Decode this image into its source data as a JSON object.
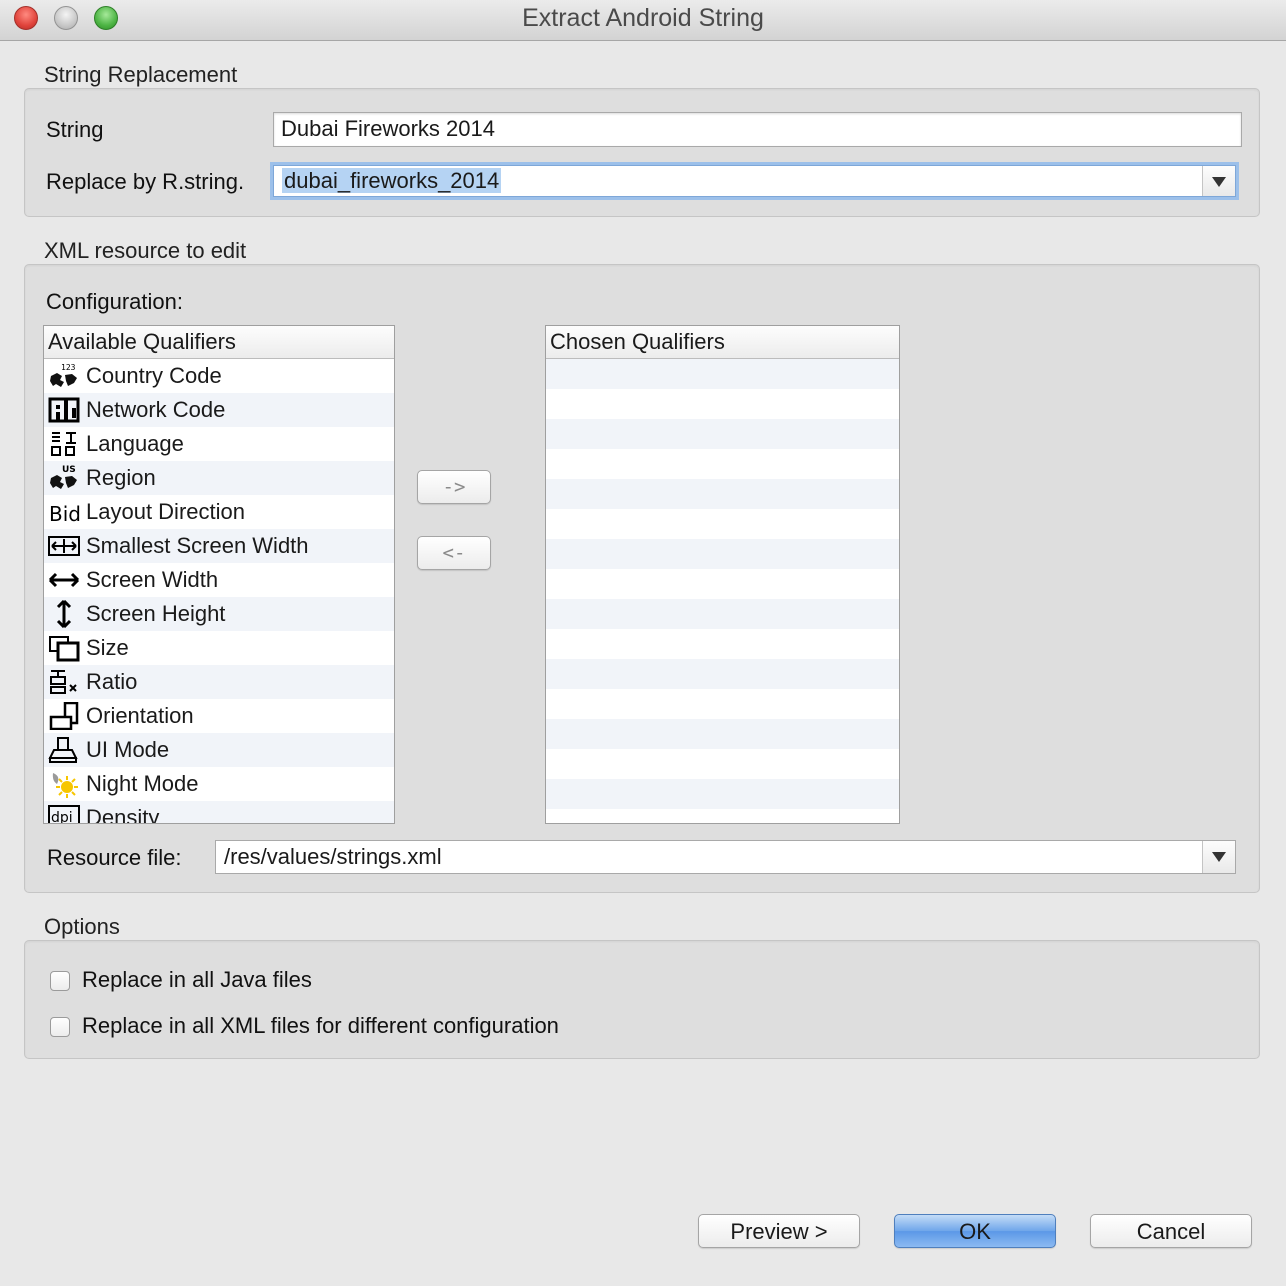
{
  "window": {
    "title": "Extract Android String"
  },
  "string_replacement": {
    "section_label": "String Replacement",
    "string_label": "String",
    "string_value": "Dubai Fireworks 2014",
    "replace_label": "Replace by R.string.",
    "replace_value": "dubai_fireworks_2014"
  },
  "xml_resource": {
    "section_label": "XML resource to edit",
    "configuration_label": "Configuration:",
    "available_header": "Available Qualifiers",
    "chosen_header": "Chosen Qualifiers",
    "add_button": "->",
    "remove_button": "<-",
    "qualifiers": [
      {
        "label": "Country Code",
        "icon": "country-code-icon"
      },
      {
        "label": "Network Code",
        "icon": "network-code-icon"
      },
      {
        "label": "Language",
        "icon": "language-icon"
      },
      {
        "label": "Region",
        "icon": "region-icon"
      },
      {
        "label": "Layout Direction",
        "icon": "layout-direction-icon"
      },
      {
        "label": "Smallest Screen Width",
        "icon": "smallest-screen-width-icon"
      },
      {
        "label": "Screen Width",
        "icon": "screen-width-icon"
      },
      {
        "label": "Screen Height",
        "icon": "screen-height-icon"
      },
      {
        "label": "Size",
        "icon": "size-icon"
      },
      {
        "label": "Ratio",
        "icon": "ratio-icon"
      },
      {
        "label": "Orientation",
        "icon": "orientation-icon"
      },
      {
        "label": "UI Mode",
        "icon": "ui-mode-icon"
      },
      {
        "label": "Night Mode",
        "icon": "night-mode-icon"
      },
      {
        "label": "Density",
        "icon": "density-icon"
      }
    ],
    "resource_file_label": "Resource file:",
    "resource_file_value": "/res/values/strings.xml"
  },
  "options": {
    "section_label": "Options",
    "replace_java": "Replace in all Java files",
    "replace_xml": "Replace in all XML files for different configuration"
  },
  "buttons": {
    "preview": "Preview >",
    "ok": "OK",
    "cancel": "Cancel"
  }
}
